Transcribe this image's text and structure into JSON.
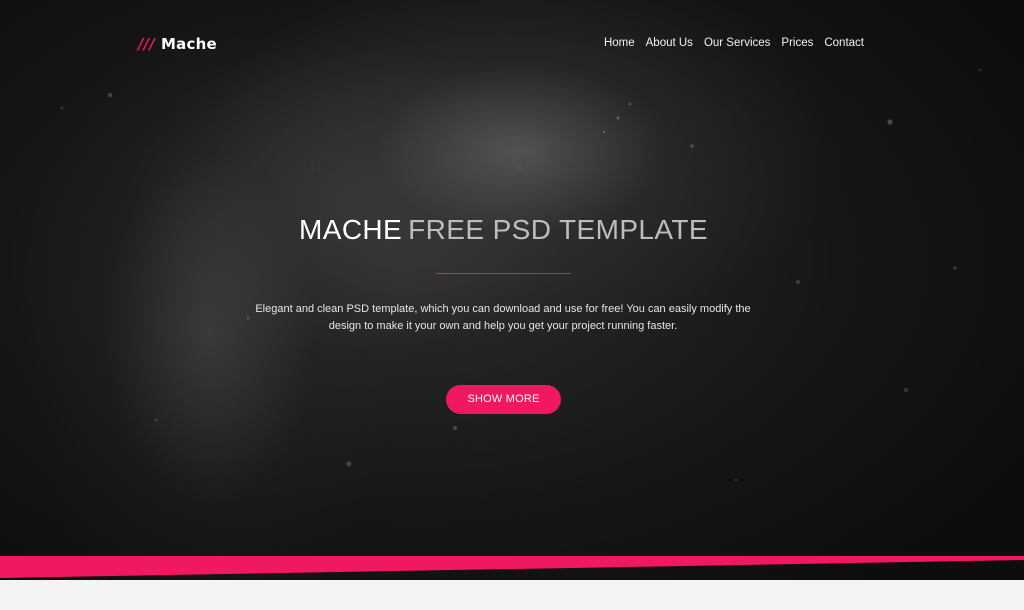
{
  "brand": {
    "mark": "///",
    "name": "Mache"
  },
  "nav": {
    "items": [
      "Home",
      "About Us",
      "Our Services",
      "Prices",
      "Contact"
    ]
  },
  "hero": {
    "title_strong": "MACHE",
    "title_light": "FREE PSD TEMPLATE",
    "description": "Elegant and clean PSD template, which you can download and use for free! You can easily modify the design to make it your own and help you get your project running faster.",
    "cta_label": "SHOW MORE"
  },
  "colors": {
    "accent": "#f0185e",
    "hero_background": "#161616",
    "footer_background": "#f4f4f4",
    "text_light": "#ffffff"
  }
}
